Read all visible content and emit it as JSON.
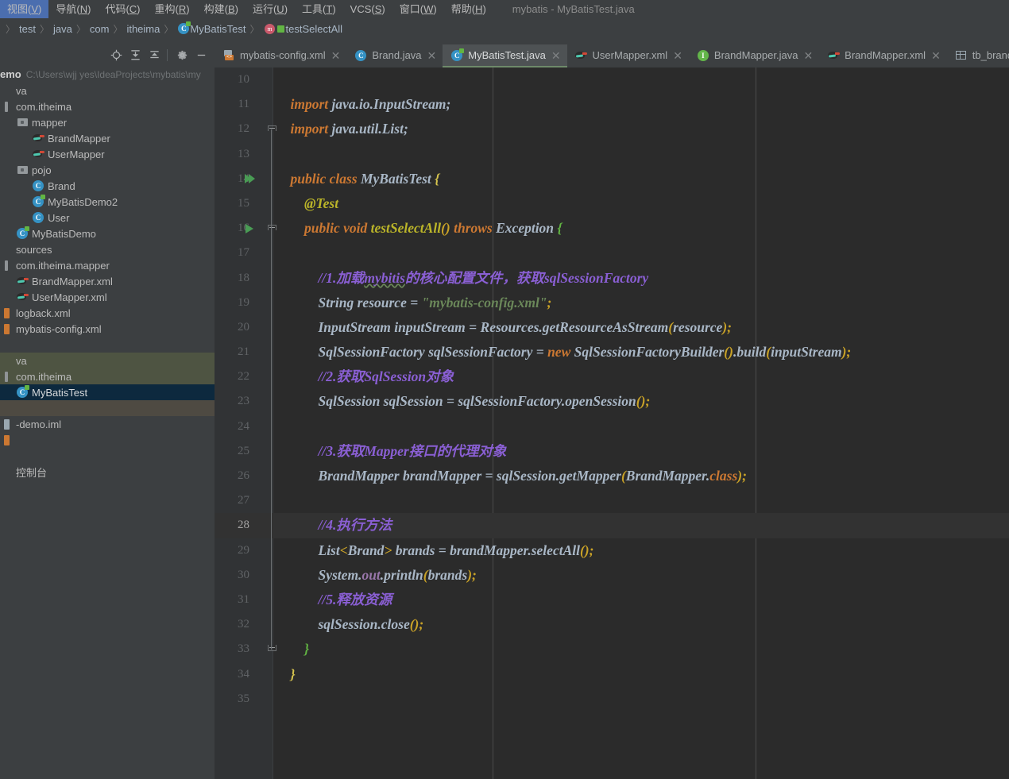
{
  "window": {
    "title": "mybatis - MyBatisTest.java",
    "accent_color": "#1a9fb5"
  },
  "menubar": {
    "items": [
      {
        "label": "视图(V)",
        "name": "menu-view"
      },
      {
        "label": "导航(N)",
        "name": "menu-navigate"
      },
      {
        "label": "代码(C)",
        "name": "menu-code"
      },
      {
        "label": "重构(R)",
        "name": "menu-refactor"
      },
      {
        "label": "构建(B)",
        "name": "menu-build"
      },
      {
        "label": "运行(U)",
        "name": "menu-run"
      },
      {
        "label": "工具(T)",
        "name": "menu-tools"
      },
      {
        "label": "VCS(S)",
        "name": "menu-vcs"
      },
      {
        "label": "窗口(W)",
        "name": "menu-window"
      },
      {
        "label": "帮助(H)",
        "name": "menu-help"
      }
    ]
  },
  "breadcrumb": {
    "items": [
      "test",
      "java",
      "com",
      "itheima",
      "MyBatisTest",
      "testSelectAll"
    ]
  },
  "project_panel": {
    "toolbar": [
      {
        "name": "locate-icon",
        "title": "Select Opened File"
      },
      {
        "name": "expand-all-icon",
        "title": "Expand All"
      },
      {
        "name": "collapse-all-icon",
        "title": "Collapse All"
      },
      {
        "name": "gear-icon",
        "title": "Settings"
      },
      {
        "name": "minimize-icon",
        "title": "Hide"
      }
    ],
    "root_name": "emo",
    "root_path": "C:\\Users\\wjj  yes\\IdeaProjects\\mybatis\\my",
    "tree": [
      {
        "label": "va",
        "icon": "folder-source",
        "indent": 0,
        "state": "normal"
      },
      {
        "label": "com.itheima",
        "icon": "package",
        "indent": 0,
        "state": "normal"
      },
      {
        "label": "mapper",
        "icon": "folder",
        "indent": 1,
        "state": "normal"
      },
      {
        "label": "BrandMapper",
        "icon": "mybatis-mapper",
        "indent": 2,
        "state": "normal"
      },
      {
        "label": "UserMapper",
        "icon": "mybatis-mapper",
        "indent": 2,
        "state": "normal"
      },
      {
        "label": "pojo",
        "icon": "folder",
        "indent": 1,
        "state": "normal"
      },
      {
        "label": "Brand",
        "icon": "class",
        "indent": 2,
        "state": "normal"
      },
      {
        "label": "MyBatisDemo2",
        "icon": "class-runnable",
        "indent": 2,
        "state": "normal"
      },
      {
        "label": "User",
        "icon": "class",
        "indent": 2,
        "state": "normal"
      },
      {
        "label": "MyBatisDemo",
        "icon": "class-runnable",
        "indent": 1,
        "state": "normal"
      },
      {
        "label": "sources",
        "icon": "none",
        "indent": 0,
        "state": "normal"
      },
      {
        "label": "com.itheima.mapper",
        "icon": "package",
        "indent": 0,
        "state": "normal"
      },
      {
        "label": "BrandMapper.xml",
        "icon": "mybatis-mapper",
        "indent": 1,
        "state": "normal"
      },
      {
        "label": "UserMapper.xml",
        "icon": "mybatis-mapper",
        "indent": 1,
        "state": "normal"
      },
      {
        "label": "logback.xml",
        "icon": "xml",
        "indent": 0,
        "state": "normal"
      },
      {
        "label": "mybatis-config.xml",
        "icon": "xml",
        "indent": 0,
        "state": "normal"
      },
      {
        "label": "",
        "icon": "none",
        "indent": 0,
        "state": "normal"
      },
      {
        "label": "va",
        "icon": "none",
        "indent": 0,
        "state": "testroot"
      },
      {
        "label": "com.itheima",
        "icon": "package",
        "indent": 0,
        "state": "testroot"
      },
      {
        "label": "MyBatisTest",
        "icon": "class-runnable",
        "indent": 1,
        "state": "selected"
      },
      {
        "label": "",
        "icon": "none",
        "indent": 0,
        "state": "band"
      },
      {
        "label": "-demo.iml",
        "icon": "iml",
        "indent": 0,
        "state": "normal"
      },
      {
        "label": "",
        "icon": "xml-partial",
        "indent": 0,
        "state": "normal"
      },
      {
        "label": "",
        "icon": "none",
        "indent": 0,
        "state": "normal"
      },
      {
        "label": "控制台",
        "icon": "none",
        "indent": 0,
        "state": "normal"
      }
    ]
  },
  "editor_tabs": [
    {
      "label": "mybatis-config.xml",
      "icon": "xml-config-icon",
      "active": false,
      "closable": true
    },
    {
      "label": "Brand.java",
      "icon": "class-icon",
      "active": false,
      "closable": true
    },
    {
      "label": "MyBatisTest.java",
      "icon": "class-runnable-icon",
      "active": true,
      "closable": true
    },
    {
      "label": "UserMapper.xml",
      "icon": "mybatis-icon",
      "active": false,
      "closable": true
    },
    {
      "label": "BrandMapper.java",
      "icon": "interface-icon",
      "active": false,
      "closable": true
    },
    {
      "label": "BrandMapper.xml",
      "icon": "mybatis-icon",
      "active": false,
      "closable": true
    },
    {
      "label": "tb_brand",
      "icon": "table-icon",
      "active": false,
      "closable": true
    }
  ],
  "editor": {
    "file": "MyBatisTest.java",
    "first_line": 10,
    "caret_line": 28,
    "lines": [
      {
        "n": 10,
        "tokens": []
      },
      {
        "n": 11,
        "tokens": [
          {
            "t": "    ",
            "c": "id"
          },
          {
            "t": "import",
            "c": "kw"
          },
          {
            "t": " java.io.InputStream;",
            "c": "id"
          }
        ]
      },
      {
        "n": 12,
        "tokens": [
          {
            "t": "    ",
            "c": "id"
          },
          {
            "t": "import",
            "c": "kw"
          },
          {
            "t": " java.util.List;",
            "c": "id"
          }
        ],
        "fold": "arr"
      },
      {
        "n": 13,
        "tokens": []
      },
      {
        "n": 14,
        "tokens": [
          {
            "t": "    ",
            "c": "id"
          },
          {
            "t": "public class",
            "c": "kw"
          },
          {
            "t": " ",
            "c": "id"
          },
          {
            "t": "MyBatisTest",
            "c": "id"
          },
          {
            "t": " ",
            "c": "id"
          },
          {
            "t": "{",
            "c": "brace-y"
          }
        ],
        "run": "double"
      },
      {
        "n": 15,
        "tokens": [
          {
            "t": "        ",
            "c": "id"
          },
          {
            "t": "@Test",
            "c": "anno"
          }
        ]
      },
      {
        "n": 16,
        "tokens": [
          {
            "t": "        ",
            "c": "id"
          },
          {
            "t": "public void",
            "c": "kw"
          },
          {
            "t": " ",
            "c": "id"
          },
          {
            "t": "testSelectAll",
            "c": "anno"
          },
          {
            "t": "()",
            "c": "par"
          },
          {
            "t": " ",
            "c": "id"
          },
          {
            "t": "throws",
            "c": "kw"
          },
          {
            "t": " Exception ",
            "c": "id"
          },
          {
            "t": "{",
            "c": "brace-g"
          }
        ],
        "run": "single",
        "fold": "arr"
      },
      {
        "n": 17,
        "tokens": []
      },
      {
        "n": 18,
        "tokens": [
          {
            "t": "            ",
            "c": "id"
          },
          {
            "t": "//1.加载",
            "c": "cmt"
          },
          {
            "t": "mybitis",
            "c": "cmt squig"
          },
          {
            "t": "的核心配置文件，获取sqlSessionFactory",
            "c": "cmt"
          }
        ]
      },
      {
        "n": 19,
        "tokens": [
          {
            "t": "            ",
            "c": "id"
          },
          {
            "t": "String resource",
            "c": "id"
          },
          {
            "t": " = ",
            "c": "id"
          },
          {
            "t": "\"mybatis-config.xml\"",
            "c": "str"
          },
          {
            "t": ";",
            "c": "par"
          }
        ]
      },
      {
        "n": 20,
        "tokens": [
          {
            "t": "            ",
            "c": "id"
          },
          {
            "t": "InputStream inputStream",
            "c": "id"
          },
          {
            "t": " = ",
            "c": "id"
          },
          {
            "t": "Resources.getResourceAsStream",
            "c": "id"
          },
          {
            "t": "(",
            "c": "par"
          },
          {
            "t": "resource",
            "c": "id"
          },
          {
            "t": ");",
            "c": "par"
          }
        ]
      },
      {
        "n": 21,
        "tokens": [
          {
            "t": "            ",
            "c": "id"
          },
          {
            "t": "SqlSessionFactory sqlSessionFactory",
            "c": "id"
          },
          {
            "t": " = ",
            "c": "id"
          },
          {
            "t": "new",
            "c": "kw"
          },
          {
            "t": " SqlSessionFactoryBuilder",
            "c": "id"
          },
          {
            "t": "()",
            "c": "par"
          },
          {
            "t": ".build",
            "c": "id"
          },
          {
            "t": "(",
            "c": "par"
          },
          {
            "t": "inputStream",
            "c": "id"
          },
          {
            "t": ");",
            "c": "par"
          }
        ]
      },
      {
        "n": 22,
        "tokens": [
          {
            "t": "            ",
            "c": "id"
          },
          {
            "t": "//2.获取SqlSession对象",
            "c": "cmt"
          }
        ]
      },
      {
        "n": 23,
        "tokens": [
          {
            "t": "            ",
            "c": "id"
          },
          {
            "t": "SqlSession sqlSession",
            "c": "id"
          },
          {
            "t": " = ",
            "c": "id"
          },
          {
            "t": "sqlSessionFactory.openSession",
            "c": "id"
          },
          {
            "t": "()",
            "c": "par"
          },
          {
            "t": ";",
            "c": "par"
          }
        ]
      },
      {
        "n": 24,
        "tokens": []
      },
      {
        "n": 25,
        "tokens": [
          {
            "t": "            ",
            "c": "id"
          },
          {
            "t": "//3.获取Mapper接口的代理对象",
            "c": "cmt"
          }
        ]
      },
      {
        "n": 26,
        "tokens": [
          {
            "t": "            ",
            "c": "id"
          },
          {
            "t": "BrandMapper brandMapper",
            "c": "id"
          },
          {
            "t": " = ",
            "c": "id"
          },
          {
            "t": "sqlSession.getMapper",
            "c": "id"
          },
          {
            "t": "(",
            "c": "par"
          },
          {
            "t": "BrandMapper.",
            "c": "id"
          },
          {
            "t": "class",
            "c": "kw"
          },
          {
            "t": ");",
            "c": "par"
          }
        ]
      },
      {
        "n": 27,
        "tokens": []
      },
      {
        "n": 28,
        "tokens": [
          {
            "t": "            ",
            "c": "id"
          },
          {
            "t": "//4.执行方法",
            "c": "cmt"
          }
        ]
      },
      {
        "n": 29,
        "tokens": [
          {
            "t": "            ",
            "c": "id"
          },
          {
            "t": "List",
            "c": "id"
          },
          {
            "t": "<",
            "c": "par"
          },
          {
            "t": "Brand",
            "c": "id"
          },
          {
            "t": ">",
            "c": "par"
          },
          {
            "t": " brands",
            "c": "id"
          },
          {
            "t": " = ",
            "c": "id"
          },
          {
            "t": "brandMapper.selectAll",
            "c": "id"
          },
          {
            "t": "()",
            "c": "par"
          },
          {
            "t": ";",
            "c": "par"
          }
        ]
      },
      {
        "n": 30,
        "tokens": [
          {
            "t": "            ",
            "c": "id"
          },
          {
            "t": "System.",
            "c": "id"
          },
          {
            "t": "out",
            "c": "fld"
          },
          {
            "t": ".println",
            "c": "id"
          },
          {
            "t": "(",
            "c": "par"
          },
          {
            "t": "brands",
            "c": "id"
          },
          {
            "t": ");",
            "c": "par"
          }
        ]
      },
      {
        "n": 31,
        "tokens": [
          {
            "t": "            ",
            "c": "id"
          },
          {
            "t": "//5.释放资源",
            "c": "cmt"
          }
        ]
      },
      {
        "n": 32,
        "tokens": [
          {
            "t": "            ",
            "c": "id"
          },
          {
            "t": "sqlSession.close",
            "c": "id"
          },
          {
            "t": "()",
            "c": "par"
          },
          {
            "t": ";",
            "c": "par"
          }
        ]
      },
      {
        "n": 33,
        "tokens": [
          {
            "t": "        ",
            "c": "id"
          },
          {
            "t": "}",
            "c": "brace-g"
          }
        ],
        "fold": "end"
      },
      {
        "n": 34,
        "tokens": [
          {
            "t": "    ",
            "c": "id"
          },
          {
            "t": "}",
            "c": "brace-y"
          }
        ]
      },
      {
        "n": 35,
        "tokens": []
      }
    ]
  }
}
